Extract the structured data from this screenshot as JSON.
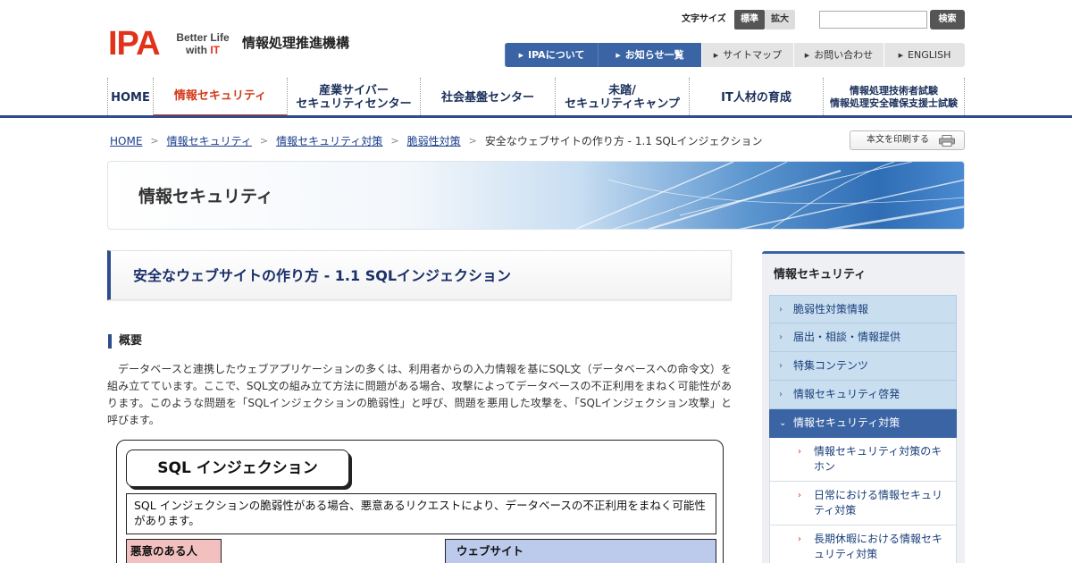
{
  "header": {
    "logo_text": "IPA",
    "logo_tagline_1": "Better Life",
    "logo_tagline_2": "with",
    "logo_tagline_it": "IT",
    "org_name": "情報処理推進機構",
    "fontsize_label": "文字サイズ",
    "fontsize_standard": "標準",
    "fontsize_large": "拡大",
    "search_value": "",
    "search_button": "検索"
  },
  "subnav": [
    "IPAについて",
    "お知らせ一覧",
    "サイトマップ",
    "お問い合わせ",
    "ENGLISH"
  ],
  "gnav": [
    {
      "label": "HOME"
    },
    {
      "label": "情報セキュリティ"
    },
    {
      "label_1": "産業サイバー",
      "label_2": "セキュリティセンター"
    },
    {
      "label": "社会基盤センター"
    },
    {
      "label_1": "未踏/",
      "label_2": "セキュリティキャンプ"
    },
    {
      "label": "IT人材の育成"
    },
    {
      "label_1": "情報処理技術者試験",
      "label_2": "情報処理安全確保支援士試験"
    }
  ],
  "breadcrumb": [
    "HOME",
    "情報セキュリティ",
    "情報セキュリティ対策",
    "脆弱性対策",
    "安全なウェブサイトの作り方 - 1.1 SQLインジェクション"
  ],
  "print_button": "本文を印刷する",
  "banner_title": "情報セキュリティ",
  "page_title": "安全なウェブサイトの作り方 - 1.1 SQLインジェクション",
  "section": {
    "heading": "概要",
    "body": "データベースと連携したウェブアプリケーションの多くは、利用者からの入力情報を基にSQL文（データベースへの命令文）を組み立てています。ここで、SQL文の組み立て方法に問題がある場合、攻撃によってデータベースの不正利用をまねく可能性があります。このような問題を「SQLインジェクションの脆弱性」と呼び、問題を悪用した攻撃を、「SQLインジェクション攻撃」と呼びます。"
  },
  "figure": {
    "title": "SQL インジェクション",
    "description": "SQL インジェクションの脆弱性がある場合、悪意あるリクエストにより、データベースの不正利用をまねく可能性があります。",
    "attacker_label": "悪意のある人",
    "site_label": "ウェブサイト"
  },
  "sidebar": {
    "title": "情報セキュリティ",
    "items": [
      "脆弱性対策情報",
      "届出・相談・情報提供",
      "特集コンテンツ",
      "情報セキュリティ啓発",
      "情報セキュリティ対策"
    ],
    "subitems": [
      "情報セキュリティ対策のキホン",
      "日常における情報セキュリティ対策",
      "長期休暇における情報セキュリティ対策"
    ]
  },
  "colors": {
    "brand_red": "#e2321a",
    "nav_blue": "#2d4d8c",
    "sidebar_active": "#3b64a5"
  }
}
